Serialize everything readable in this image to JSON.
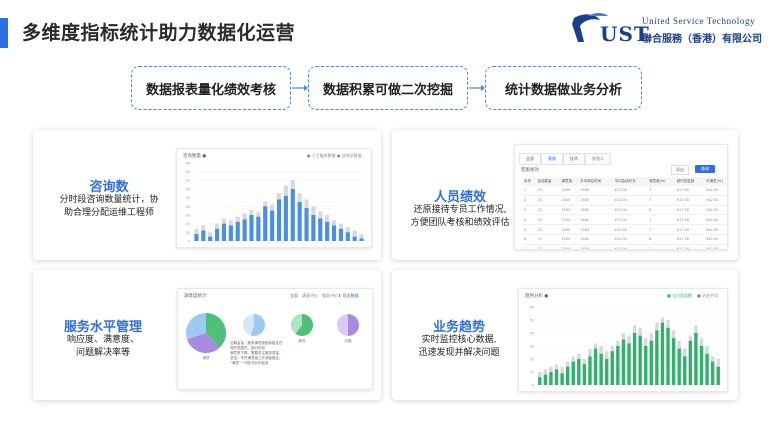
{
  "header": {
    "title": "多维度指标统计助力数据化运营",
    "accent_color": "#2f6fe4"
  },
  "logo": {
    "mark": "UST",
    "english": "United Service Technology",
    "chinese": "聯合服務（香港）有限公司",
    "brand_color": "#1a3f8f"
  },
  "flow": {
    "steps": [
      "数据报表量化绩效考核",
      "数据积累可做二次挖掘",
      "统计数据做业务分析"
    ],
    "arrow_icon": "arrow-right-icon"
  },
  "cards": {
    "inquiry": {
      "title": "咨询数",
      "desc_line1": "分时段咨询数量统计，协",
      "desc_line2": "助合理分配运维工程师",
      "preview_title": "咨询数量 ●",
      "legend": [
        "● 人工服务数量",
        "● 咨询总数量"
      ],
      "y_ticks": [
        "90",
        "80",
        "70",
        "60",
        "50",
        "40",
        "30",
        "20",
        "10",
        "0"
      ],
      "bars_primary": [
        8,
        12,
        5,
        14,
        20,
        18,
        22,
        25,
        30,
        28,
        40,
        35,
        48,
        52,
        60,
        45,
        38,
        30,
        26,
        22,
        18,
        14,
        10,
        5,
        3
      ],
      "bars_secondary": [
        14,
        18,
        10,
        20,
        26,
        24,
        28,
        32,
        36,
        34,
        46,
        42,
        55,
        64,
        70,
        55,
        48,
        40,
        34,
        30,
        24,
        20,
        16,
        12,
        8
      ],
      "colors": {
        "primary": "#4a90e2",
        "secondary": "#d6d9de"
      }
    },
    "staff": {
      "title": "人员绩效",
      "desc_line1": "还原接待专员工作情况,",
      "desc_line2": "方便团队考核和绩效评估",
      "tabs": [
        "全部",
        "客服",
        "技术",
        "外包人"
      ],
      "active_tab": 1,
      "section_label": "客服绩效",
      "export_label": "导出",
      "search_label": "查询",
      "columns": [
        "序号",
        "会话数量",
        "满意量",
        "平均响应时间",
        "平均会话时长",
        "满意度(%)",
        "超时回复数",
        "不满意(%)"
      ],
      "rows": [
        [
          "1",
          "21",
          "1500",
          "1580",
          "¥12.00",
          "7",
          "¥17.00",
          "¥42.00"
        ],
        [
          "2",
          "20",
          "1500",
          "1580",
          "¥12.00",
          "7",
          "¥17.00",
          "¥42.00"
        ],
        [
          "3",
          "21",
          "1500",
          "1580",
          "¥12.00",
          "8",
          "¥17.00",
          "¥42.00"
        ],
        [
          "4",
          "20",
          "1500",
          "1580",
          "¥12.00",
          "7",
          "¥17.00",
          "¥42.00"
        ],
        [
          "5",
          "21",
          "1500",
          "1580",
          "¥12.00",
          "7",
          "¥17.00",
          "¥42.00"
        ],
        [
          "6",
          "21",
          "1500",
          "1580",
          "¥12.00",
          "8",
          "¥17.00",
          "¥42.00"
        ],
        [
          "7",
          "22",
          "1500",
          "1580",
          "¥12.00",
          "7",
          "¥17.00",
          "¥42.00"
        ],
        [
          "8",
          "20",
          "1500",
          "1580",
          "¥12.00",
          "7",
          "¥17.00",
          "¥42.00"
        ],
        [
          "9",
          "21",
          "1500",
          "1580",
          "¥12.00",
          "7",
          "¥17.00",
          "¥42.00"
        ]
      ]
    },
    "service": {
      "title": "服务水平管理",
      "desc_line1": "响应度、满意度、",
      "desc_line2": "问题解决率等",
      "preview_title": "满意度统计",
      "tabs": [
        "全部",
        "满意评价",
        "服务评价"
      ],
      "export_label": "⬇ 导出数据",
      "pie_labels": [
        "满意",
        "",
        "服务",
        "问题"
      ],
      "note_lines": [
        "近期会话，服务满意度指标稳定在",
        "良好范围内，部分时段",
        "满意率下降，需要关注服务质量",
        "总结：专员满意度上升或者稳定，",
        "“满意”一词在评价中较多"
      ],
      "pies": [
        {
          "slices": [
            0.38,
            0.32,
            0.3
          ],
          "colors": [
            "#4fc07a",
            "#a88be0",
            "#9ec9f0"
          ]
        },
        {
          "slices": [
            0.55,
            0.45
          ],
          "colors": [
            "#9ec9f0",
            "#d5e8f8"
          ]
        },
        {
          "slices": [
            0.6,
            0.4
          ],
          "colors": [
            "#4fc07a",
            "#a9e6c1"
          ]
        },
        {
          "slices": [
            0.5,
            0.5
          ],
          "colors": [
            "#a88be0",
            "#d9ccf3"
          ]
        }
      ]
    },
    "trend": {
      "title": "业务趋势",
      "desc_line1": "实时监控核心数据,",
      "desc_line2": "迅速发现并解决问题",
      "preview_title": "趋势分析 ●",
      "legend": [
        "■ 当日会话数",
        "■ 历史平均"
      ],
      "y_ticks": [
        "60",
        "50",
        "40",
        "30",
        "20",
        "10",
        "0"
      ],
      "bars_primary": [
        6,
        8,
        10,
        12,
        9,
        14,
        18,
        20,
        16,
        22,
        28,
        24,
        20,
        26,
        30,
        35,
        32,
        40,
        38,
        30,
        34,
        42,
        48,
        44,
        36,
        28,
        22,
        34,
        40,
        30,
        24,
        18,
        14
      ],
      "bars_secondary": [
        10,
        12,
        14,
        16,
        14,
        18,
        22,
        24,
        20,
        28,
        32,
        30,
        26,
        30,
        34,
        40,
        38,
        46,
        44,
        36,
        40,
        48,
        52,
        50,
        42,
        34,
        28,
        38,
        46,
        36,
        30,
        22,
        20
      ],
      "colors": {
        "primary": "#2fb26a",
        "secondary": "#d6d9de"
      }
    }
  }
}
